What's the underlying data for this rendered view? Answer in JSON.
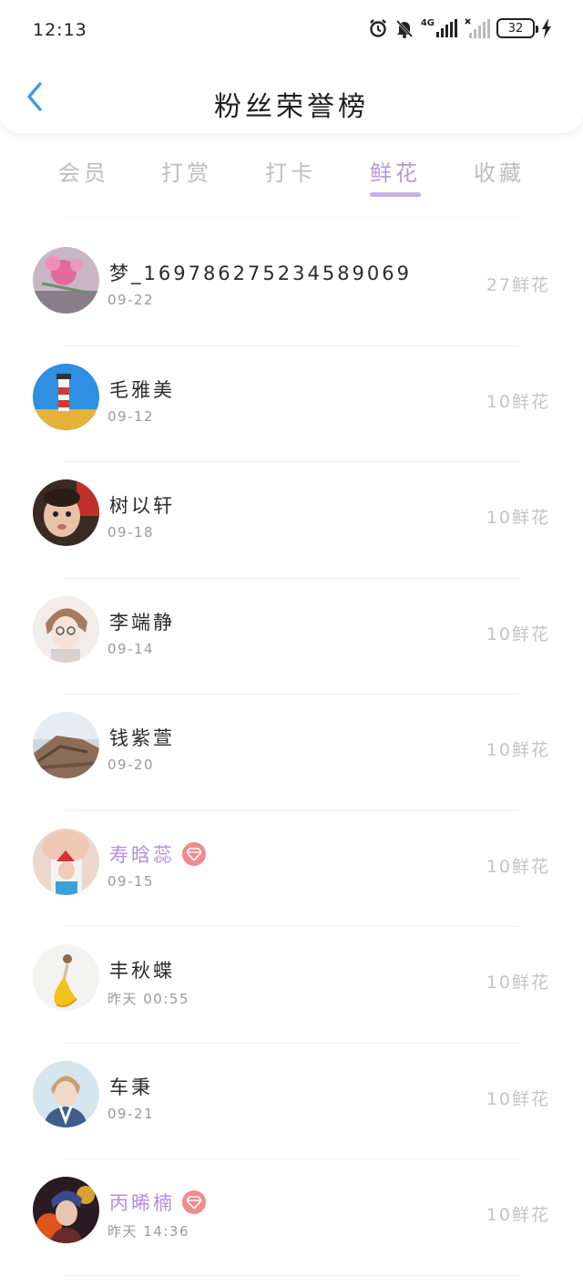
{
  "status_bar": {
    "time": "12:13",
    "network": "4G",
    "battery": "32",
    "icons": [
      "alarm-icon",
      "mute-bell-icon",
      "signal-4g-icon",
      "signal-no-sim-icon",
      "battery-icon",
      "charging-icon"
    ]
  },
  "header": {
    "back_icon": "chevron-left-icon",
    "title": "粉丝荣誉榜"
  },
  "colors": {
    "accent": "#c8aee6",
    "active_tab": "#b89ad6",
    "vip_name": "#b48de0",
    "vip_badge": "#f28a8f",
    "back_icon": "#3d9be9"
  },
  "tabs": [
    {
      "label": "会员",
      "active": false
    },
    {
      "label": "打赏",
      "active": false
    },
    {
      "label": "打卡",
      "active": false
    },
    {
      "label": "鲜花",
      "active": true
    },
    {
      "label": "收藏",
      "active": false
    }
  ],
  "fans": [
    {
      "name": "梦_169786275234589069",
      "date": "09-22",
      "flowers": "27鲜花",
      "vip": false,
      "avatar": "flowers-photo"
    },
    {
      "name": "毛雅美",
      "date": "09-12",
      "flowers": "10鲜花",
      "vip": false,
      "avatar": "lighthouse-photo"
    },
    {
      "name": "树以轩",
      "date": "09-18",
      "flowers": "10鲜花",
      "vip": false,
      "avatar": "baby-photo"
    },
    {
      "name": "李端静",
      "date": "09-14",
      "flowers": "10鲜花",
      "vip": false,
      "avatar": "anime-boy-drawing"
    },
    {
      "name": "钱紫萱",
      "date": "09-20",
      "flowers": "10鲜花",
      "vip": false,
      "avatar": "rock-landscape-photo"
    },
    {
      "name": "寿晗蕊",
      "date": "09-15",
      "flowers": "10鲜花",
      "vip": true,
      "avatar": "child-selfie-photo"
    },
    {
      "name": "丰秋蝶",
      "date": "昨天 00:55",
      "flowers": "10鲜花",
      "vip": false,
      "avatar": "dancer-illustration"
    },
    {
      "name": "车秉",
      "date": "09-21",
      "flowers": "10鲜花",
      "vip": false,
      "avatar": "young-man-photo"
    },
    {
      "name": "丙晞楠",
      "date": "昨天 14:36",
      "flowers": "10鲜花",
      "vip": true,
      "avatar": "anime-fire-character"
    }
  ]
}
